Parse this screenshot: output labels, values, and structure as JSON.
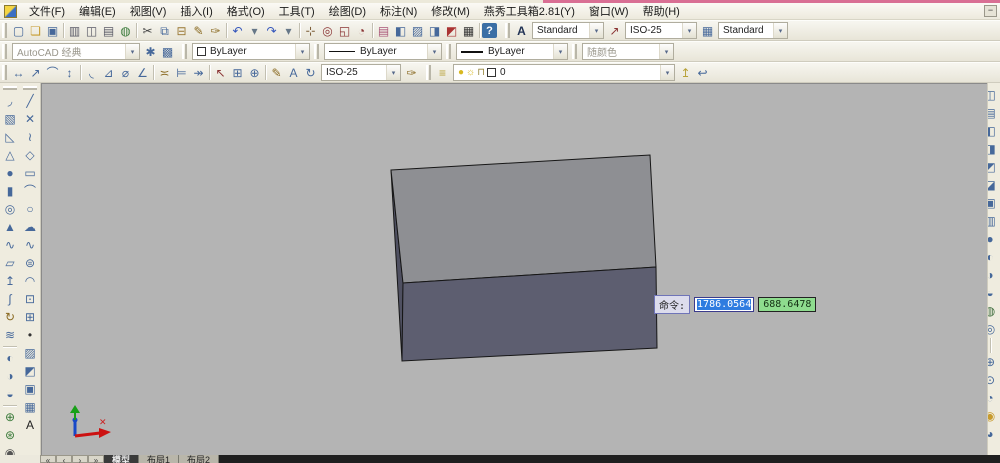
{
  "window": {
    "minimize_label": "−",
    "pink_strip_color": "#d96f94"
  },
  "menu": {
    "items": [
      {
        "name": "menu-file",
        "label": "文件(F)"
      },
      {
        "name": "menu-edit",
        "label": "编辑(E)"
      },
      {
        "name": "menu-view",
        "label": "视图(V)"
      },
      {
        "name": "menu-insert",
        "label": "插入(I)"
      },
      {
        "name": "menu-format",
        "label": "格式(O)"
      },
      {
        "name": "menu-tools",
        "label": "工具(T)"
      },
      {
        "name": "menu-draw",
        "label": "绘图(D)"
      },
      {
        "name": "menu-dimension",
        "label": "标注(N)"
      },
      {
        "name": "menu-modify",
        "label": "修改(M)"
      },
      {
        "name": "menu-yanxiu-toolbox",
        "label": "燕秀工具箱2.81(Y)"
      },
      {
        "name": "menu-window",
        "label": "窗口(W)"
      },
      {
        "name": "menu-help",
        "label": "帮助(H)"
      }
    ]
  },
  "standard_toolbar": {
    "icons": [
      {
        "name": "new-icon",
        "glyph": "▢",
        "color": "#46689a"
      },
      {
        "name": "open-icon",
        "glyph": "❏",
        "color": "#c79b2e"
      },
      {
        "name": "save-icon",
        "glyph": "▣",
        "color": "#46689a"
      },
      {
        "type": "sep"
      },
      {
        "name": "plot-icon",
        "glyph": "▥",
        "color": "#5a5a66"
      },
      {
        "name": "plot-preview-icon",
        "glyph": "◫",
        "color": "#5a5a66"
      },
      {
        "name": "publish-icon",
        "glyph": "▤",
        "color": "#5a5a66"
      },
      {
        "name": "publish-web-icon",
        "glyph": "◍",
        "color": "#3a7a3a"
      },
      {
        "type": "sep"
      },
      {
        "name": "cut-icon",
        "glyph": "✂",
        "color": "#444444"
      },
      {
        "name": "copy-icon",
        "glyph": "⧉",
        "color": "#46689a"
      },
      {
        "name": "paste-icon",
        "glyph": "⊟",
        "color": "#997733"
      },
      {
        "name": "block-editor-icon",
        "glyph": "✎",
        "color": "#8a6a22"
      },
      {
        "name": "match-properties-icon",
        "glyph": "✑",
        "color": "#8a6a22"
      },
      {
        "type": "sep"
      },
      {
        "name": "undo-icon",
        "glyph": "↶",
        "color": "#3355bb"
      },
      {
        "name": "undo-dropdown-icon",
        "glyph": "▾",
        "color": "#667788"
      },
      {
        "name": "redo-icon",
        "glyph": "↷",
        "color": "#3355bb"
      },
      {
        "name": "redo-dropdown-icon",
        "glyph": "▾",
        "color": "#667788"
      },
      {
        "type": "sep"
      },
      {
        "name": "pan-icon",
        "glyph": "⊹",
        "color": "#7a5a33"
      },
      {
        "name": "zoom-realtime-icon",
        "glyph": "◎",
        "color": "#8a3333"
      },
      {
        "name": "zoom-window-icon",
        "glyph": "◱",
        "color": "#8a3333"
      },
      {
        "name": "zoom-previous-icon",
        "glyph": "◔",
        "color": "#8a3333"
      },
      {
        "type": "sep"
      },
      {
        "name": "properties-icon",
        "glyph": "▤",
        "color": "#aa5577"
      },
      {
        "name": "designcenter-icon",
        "glyph": "◧",
        "color": "#46689a"
      },
      {
        "name": "tool-palettes-icon",
        "glyph": "▨",
        "color": "#46689a"
      },
      {
        "name": "sheetset-manager-icon",
        "glyph": "◨",
        "color": "#46689a"
      },
      {
        "name": "markup-manager-icon",
        "glyph": "◩",
        "color": "#aa3333"
      },
      {
        "name": "quickcalc-icon",
        "glyph": "▦",
        "color": "#333333"
      },
      {
        "type": "sep"
      }
    ],
    "help_glyph": "?"
  },
  "styles_toolbar": {
    "text_style_value": "Standard",
    "dim_style_value": "ISO-25",
    "table_style_value": "Standard",
    "text_style_icon": "A",
    "dim_style_icon": "↗",
    "table_style_icon": "▦"
  },
  "workspace_toolbar": {
    "value": "AutoCAD 经典",
    "icons": [
      {
        "name": "workspace-settings-icon",
        "glyph": "✱",
        "color": "#46689a"
      },
      {
        "name": "my-workspace-icon",
        "glyph": "▩",
        "color": "#46689a"
      }
    ]
  },
  "properties_toolbar": {
    "color_value": "ByLayer",
    "linetype_value": "ByLayer",
    "lineweight_value": "ByLayer",
    "plot_style_value": "随颜色"
  },
  "dimension_toolbar": {
    "icons": [
      {
        "name": "dim-linear-icon",
        "glyph": "↔",
        "color": "#46689a"
      },
      {
        "name": "dim-aligned-icon",
        "glyph": "↗",
        "color": "#46689a"
      },
      {
        "name": "dim-arc-length-icon",
        "glyph": "⌒",
        "color": "#46689a"
      },
      {
        "name": "dim-ordinate-icon",
        "glyph": "↕",
        "color": "#46689a"
      },
      {
        "type": "sep"
      },
      {
        "name": "dim-radius-icon",
        "glyph": "◟",
        "color": "#46689a"
      },
      {
        "name": "dim-jogged-icon",
        "glyph": "⊿",
        "color": "#46689a"
      },
      {
        "name": "dim-diameter-icon",
        "glyph": "⌀",
        "color": "#46689a"
      },
      {
        "name": "dim-angular-icon",
        "glyph": "∠",
        "color": "#46689a"
      },
      {
        "type": "sep"
      },
      {
        "name": "quick-dimension-icon",
        "glyph": "≍",
        "color": "#8a6a22"
      },
      {
        "name": "dim-baseline-icon",
        "glyph": "⊨",
        "color": "#46689a"
      },
      {
        "name": "dim-continue-icon",
        "glyph": "↠",
        "color": "#46689a"
      },
      {
        "type": "sep"
      },
      {
        "name": "quick-leader-icon",
        "glyph": "↖",
        "color": "#8a3333"
      },
      {
        "name": "tolerance-icon",
        "glyph": "⊞",
        "color": "#46689a"
      },
      {
        "name": "center-mark-icon",
        "glyph": "⊕",
        "color": "#46689a"
      },
      {
        "type": "sep"
      },
      {
        "name": "dim-edit-icon",
        "glyph": "✎",
        "color": "#8a6a22"
      },
      {
        "name": "dim-text-edit-icon",
        "glyph": "A",
        "color": "#46689a"
      },
      {
        "name": "dim-update-icon",
        "glyph": "↻",
        "color": "#46689a"
      }
    ],
    "style_value": "ISO-25",
    "style_icon": "✑"
  },
  "layers_toolbar": {
    "manager_icon": "≡",
    "on_glyph": "●",
    "freeze_glyph": "☼",
    "lock_glyph": "⊓",
    "layer_name": "0",
    "make_current_icon": "↥",
    "layer_previous_icon": "↩"
  },
  "modeling_toolbar": {
    "icons": [
      {
        "name": "polysolid-icon",
        "glyph": "◞",
        "color": "#46689a"
      },
      {
        "name": "box-icon",
        "glyph": "▧",
        "color": "#46689a"
      },
      {
        "name": "wedge-icon",
        "glyph": "◺",
        "color": "#46689a"
      },
      {
        "name": "cone-icon",
        "glyph": "△",
        "color": "#46689a"
      },
      {
        "name": "sphere-icon",
        "glyph": "●",
        "color": "#46689a"
      },
      {
        "name": "cylinder-icon",
        "glyph": "▮",
        "color": "#46689a"
      },
      {
        "name": "torus-icon",
        "glyph": "◎",
        "color": "#46689a"
      },
      {
        "name": "pyramid-icon",
        "glyph": "▲",
        "color": "#46689a"
      },
      {
        "name": "helix-icon",
        "glyph": "∿",
        "color": "#46689a"
      },
      {
        "name": "planar-surface-icon",
        "glyph": "▱",
        "color": "#46689a"
      },
      {
        "name": "extrude-icon",
        "glyph": "↥",
        "color": "#46689a"
      },
      {
        "name": "sweep-icon",
        "glyph": "∫",
        "color": "#46689a"
      },
      {
        "name": "revolve-icon",
        "glyph": "↻",
        "color": "#8a6a22"
      },
      {
        "name": "loft-icon",
        "glyph": "≋",
        "color": "#46689a"
      },
      {
        "type": "sep"
      },
      {
        "name": "union-icon",
        "glyph": "◐",
        "color": "#46689a"
      },
      {
        "name": "subtract-icon",
        "glyph": "◑",
        "color": "#46689a"
      },
      {
        "name": "intersect-icon",
        "glyph": "◒",
        "color": "#46689a"
      },
      {
        "type": "sep"
      },
      {
        "name": "orbit-3d-icon",
        "glyph": "⊕",
        "color": "#3a7a3a"
      },
      {
        "name": "free-orbit-icon",
        "glyph": "⊛",
        "color": "#3a7a3a"
      },
      {
        "name": "camera-icon",
        "glyph": "◉",
        "color": "#555555"
      }
    ]
  },
  "draw_toolbar": {
    "icons": [
      {
        "name": "line-icon",
        "glyph": "╱",
        "color": "#46689a"
      },
      {
        "name": "construction-line-icon",
        "glyph": "✕",
        "color": "#46689a"
      },
      {
        "name": "polyline-icon",
        "glyph": "≀",
        "color": "#46689a"
      },
      {
        "name": "polygon-icon",
        "glyph": "◇",
        "color": "#46689a"
      },
      {
        "name": "rectangle-icon",
        "glyph": "▭",
        "color": "#46689a"
      },
      {
        "name": "arc-icon",
        "glyph": "⌒",
        "color": "#46689a"
      },
      {
        "name": "circle-icon",
        "glyph": "○",
        "color": "#46689a"
      },
      {
        "name": "revcloud-icon",
        "glyph": "☁",
        "color": "#46689a"
      },
      {
        "name": "spline-icon",
        "glyph": "∿",
        "color": "#46689a"
      },
      {
        "name": "ellipse-icon",
        "glyph": "⊜",
        "color": "#46689a"
      },
      {
        "name": "ellipse-arc-icon",
        "glyph": "◠",
        "color": "#46689a"
      },
      {
        "name": "insert-block-icon",
        "glyph": "⊡",
        "color": "#46689a"
      },
      {
        "name": "make-block-icon",
        "glyph": "⊞",
        "color": "#46689a"
      },
      {
        "name": "point-icon",
        "glyph": "•",
        "color": "#333333"
      },
      {
        "name": "hatch-icon",
        "glyph": "▨",
        "color": "#46689a"
      },
      {
        "name": "gradient-icon",
        "glyph": "◩",
        "color": "#46689a"
      },
      {
        "name": "region-icon",
        "glyph": "▣",
        "color": "#46689a"
      },
      {
        "name": "table-icon",
        "glyph": "▦",
        "color": "#46689a"
      },
      {
        "name": "mtext-icon",
        "glyph": "A",
        "color": "#222222"
      }
    ]
  },
  "right_toolbar": {
    "icons": [
      {
        "name": "clipped-toolbar-icon",
        "glyph": "◫",
        "color": "#46689a"
      },
      {
        "name": "clipped-toolbar-icon",
        "glyph": "▤",
        "color": "#46689a"
      },
      {
        "name": "clipped-toolbar-icon",
        "glyph": "◧",
        "color": "#46689a"
      },
      {
        "name": "clipped-toolbar-icon",
        "glyph": "◨",
        "color": "#46689a"
      },
      {
        "name": "clipped-toolbar-icon",
        "glyph": "◩",
        "color": "#46689a"
      },
      {
        "name": "clipped-toolbar-icon",
        "glyph": "◪",
        "color": "#46689a"
      },
      {
        "name": "clipped-toolbar-icon",
        "glyph": "▣",
        "color": "#46689a"
      },
      {
        "name": "clipped-toolbar-icon",
        "glyph": "▥",
        "color": "#46689a"
      },
      {
        "name": "clipped-toolbar-icon",
        "glyph": "●",
        "color": "#46689a"
      },
      {
        "name": "clipped-toolbar-icon",
        "glyph": "◐",
        "color": "#46689a"
      },
      {
        "name": "clipped-toolbar-icon",
        "glyph": "◑",
        "color": "#46689a"
      },
      {
        "name": "clipped-toolbar-icon",
        "glyph": "◒",
        "color": "#46689a"
      },
      {
        "name": "clipped-toolbar-icon",
        "glyph": "◍",
        "color": "#3a6a3a"
      },
      {
        "name": "clipped-toolbar-icon",
        "glyph": "◎",
        "color": "#46689a"
      },
      {
        "type": "sep"
      },
      {
        "name": "clipped-toolbar-icon",
        "glyph": "⊕",
        "color": "#46689a"
      },
      {
        "name": "clipped-toolbar-icon",
        "glyph": "⊙",
        "color": "#46689a"
      },
      {
        "name": "clipped-toolbar-icon",
        "glyph": "◔",
        "color": "#46689a"
      },
      {
        "name": "clipped-toolbar-icon",
        "glyph": "◉",
        "color": "#c79b2e"
      },
      {
        "name": "clipped-toolbar-icon",
        "glyph": "◕",
        "color": "#46689a"
      }
    ]
  },
  "canvas": {
    "background": "#b4b4b4",
    "box": {
      "top": "#8e8f93",
      "front": "#5d5e70",
      "side": "#4f5061",
      "outline": "#161616"
    },
    "ucs": {
      "x": "#cc1111",
      "y": "#18a018",
      "z": "#1848c8",
      "marker": "#cc2222",
      "cursor_glyph": "✕"
    },
    "dynamic_input": {
      "label": "命令:",
      "value_x": "1786.0564",
      "value_y": "688.6478"
    }
  },
  "layout_tabs": {
    "nav": [
      {
        "name": "tab-nav-first",
        "glyph": "«"
      },
      {
        "name": "tab-nav-prev",
        "glyph": "‹"
      },
      {
        "name": "tab-nav-next",
        "glyph": "›"
      },
      {
        "name": "tab-nav-last",
        "glyph": "»"
      }
    ],
    "tabs": [
      {
        "name": "tab-model",
        "label": "模型",
        "selected": true
      },
      {
        "name": "tab-layout1",
        "label": "布局1"
      },
      {
        "name": "tab-layout2",
        "label": "布局2"
      }
    ]
  }
}
